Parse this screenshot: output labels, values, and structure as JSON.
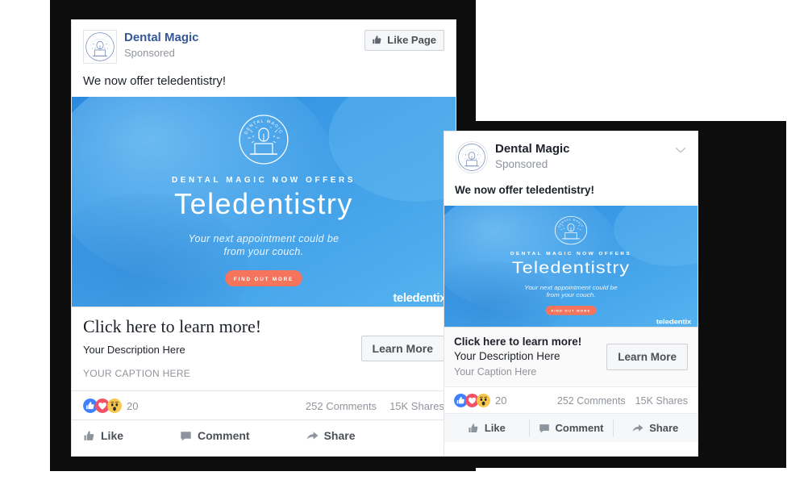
{
  "page": {
    "background_color": "#ffffff",
    "frame_color": "#0d0d0d"
  },
  "card_desktop": {
    "page_name": "Dental Magic",
    "sponsored_label": "Sponsored",
    "like_page_label": "Like Page",
    "message": "We now offer teledentistry!",
    "link_title": "Click here to learn more!",
    "link_description": "Your Description Here",
    "link_caption": "YOUR CAPTION HERE",
    "cta_label": "Learn More",
    "reaction_count": "20",
    "comments": "252 Comments",
    "shares": "15K Shares",
    "actions": [
      {
        "label": "Like",
        "icon": "thumbs-up-icon"
      },
      {
        "label": "Comment",
        "icon": "comment-bubble-icon"
      },
      {
        "label": "Share",
        "icon": "share-arrow-icon"
      }
    ]
  },
  "card_mobile": {
    "page_name": "Dental Magic",
    "sponsored_label": "Sponsored",
    "message": "We now offer teledentistry!",
    "link_title": "Click here to learn more!",
    "link_description": "Your Description Here",
    "link_caption": "Your Caption Here",
    "cta_label": "Learn More",
    "reaction_count": "20",
    "comments": "252 Comments",
    "shares": "15K Shares",
    "actions": [
      {
        "label": "Like",
        "icon": "thumbs-up-icon"
      },
      {
        "label": "Comment",
        "icon": "comment-bubble-icon"
      },
      {
        "label": "Share",
        "icon": "share-arrow-icon"
      }
    ]
  },
  "creative": {
    "logo_ring_text": "DENTAL MAGIC",
    "eyebrow": "DENTAL MAGIC NOW OFFERS",
    "headline": "Teledentistry",
    "subhead_line1": "Your next appointment could be",
    "subhead_line2": "from your couch.",
    "button_label": "FIND OUT MORE",
    "watermark": "teledentix",
    "colors": {
      "gradient_start": "#2a8ade",
      "gradient_end": "#54b2f0",
      "blob_light": "#63b9f2",
      "button": "#f4745c",
      "text": "#ffffff"
    }
  },
  "reaction_colors": {
    "like": "#4080ff",
    "love": "#f25268",
    "wow": "#f7c64b"
  }
}
